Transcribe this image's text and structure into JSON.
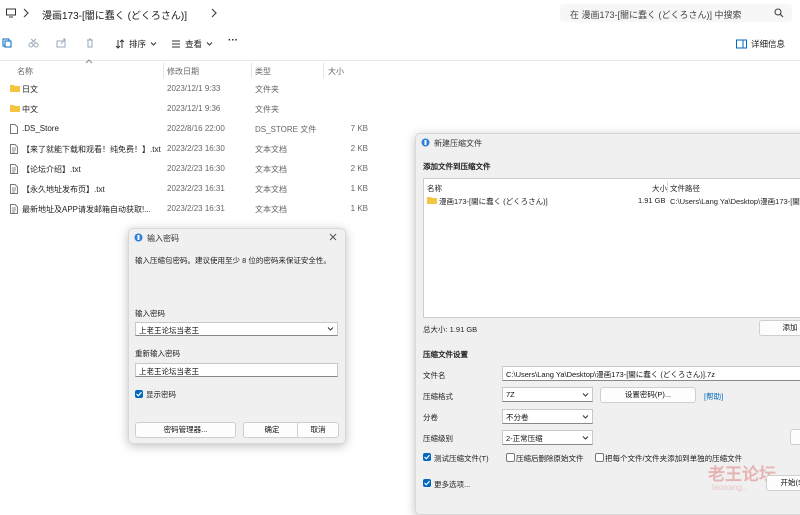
{
  "explorer": {
    "breadcrumb": "漫画173-[闇に蠢く (どくろさん)]",
    "search_placeholder": "在 漫画173-[闇に蠢く (どくろさん)] 中搜索",
    "toolbar": {
      "sort": "排序",
      "view": "查看",
      "more": "···",
      "details": "详细信息"
    },
    "columns": {
      "name": "名称",
      "modified": "修改日期",
      "type": "类型",
      "size": "大小"
    },
    "rows": [
      {
        "icon": "folder-icon",
        "name": "日文",
        "modified": "2023/12/1 9:33",
        "type": "文件夹",
        "size": ""
      },
      {
        "icon": "folder-icon",
        "name": "中文",
        "modified": "2023/12/1 9:36",
        "type": "文件夹",
        "size": ""
      },
      {
        "icon": "file-icon",
        "name": ".DS_Store",
        "modified": "2022/8/16 22:00",
        "type": "DS_STORE 文件",
        "size": "7 KB"
      },
      {
        "icon": "text-file-icon",
        "name": "【来了就能下载和观看！纯免费！】.txt",
        "modified": "2023/2/23 16:30",
        "type": "文本文档",
        "size": "2 KB"
      },
      {
        "icon": "text-file-icon",
        "name": "【论坛介绍】.txt",
        "modified": "2023/2/23 16:30",
        "type": "文本文档",
        "size": "2 KB"
      },
      {
        "icon": "text-file-icon",
        "name": "【永久地址发布页】.txt",
        "modified": "2023/2/23 16:31",
        "type": "文本文档",
        "size": "1 KB"
      },
      {
        "icon": "text-file-icon",
        "name": "最新地址及APP请发邮箱自动获取!...",
        "modified": "2023/2/23 16:31",
        "type": "文本文档",
        "size": "1 KB"
      }
    ]
  },
  "password_dialog": {
    "title": "输入密码",
    "hint": "输入压缩包密码。建议使用至少 8 位的密码来保证安全性。",
    "password_label": "输入密码",
    "password_value": "上老王论坛当老王",
    "confirm_label": "重新输入密码",
    "confirm_value": "上老王论坛当老王",
    "show_password": "显示密码",
    "manager_button": "密码管理器...",
    "ok_button": "确定",
    "cancel_button": "取消"
  },
  "archive_dialog": {
    "title": "新建压缩文件",
    "section_files": "添加文件到压缩文件",
    "col_name": "名称",
    "col_size": "大小",
    "col_path": "文件路径",
    "file_row": {
      "name": "漫画173-[闇に蠢く (どくろさん)]",
      "size": "1.91 GB",
      "path": "C:\\Users\\Lang Ya\\Desktop\\漫画173-[闇に"
    },
    "total_size": "总大小: 1.91 GB",
    "add_button": "添加",
    "section_settings": "压缩文件设置",
    "file_label": "文件名",
    "file_value": "C:\\Users\\Lang Ya\\Desktop\\漫画173-[闇に蠢く (どくろさん)].7z",
    "format_label": "压缩格式",
    "format_value": "7Z",
    "set_password_button": "设置密码(P)...",
    "help_link": "[帮助]",
    "split_label": "分卷",
    "split_value": "不分卷",
    "level_label": "压缩级别",
    "level_value": "2-正常压缩",
    "test_check": "测试压缩文件(T)",
    "delete_check": "压缩后删除原始文件",
    "separate_check": "把每个文件/文件夹添加到单独的压缩文件",
    "more_options": "更多选项...",
    "start_button": "开始(S)",
    "watermark": "老王论坛",
    "watermark_sub": "laowang..."
  },
  "colors": {
    "accent": "#0067c0",
    "folder": "#f4c542",
    "dialog_bg": "#f0f0f0"
  }
}
